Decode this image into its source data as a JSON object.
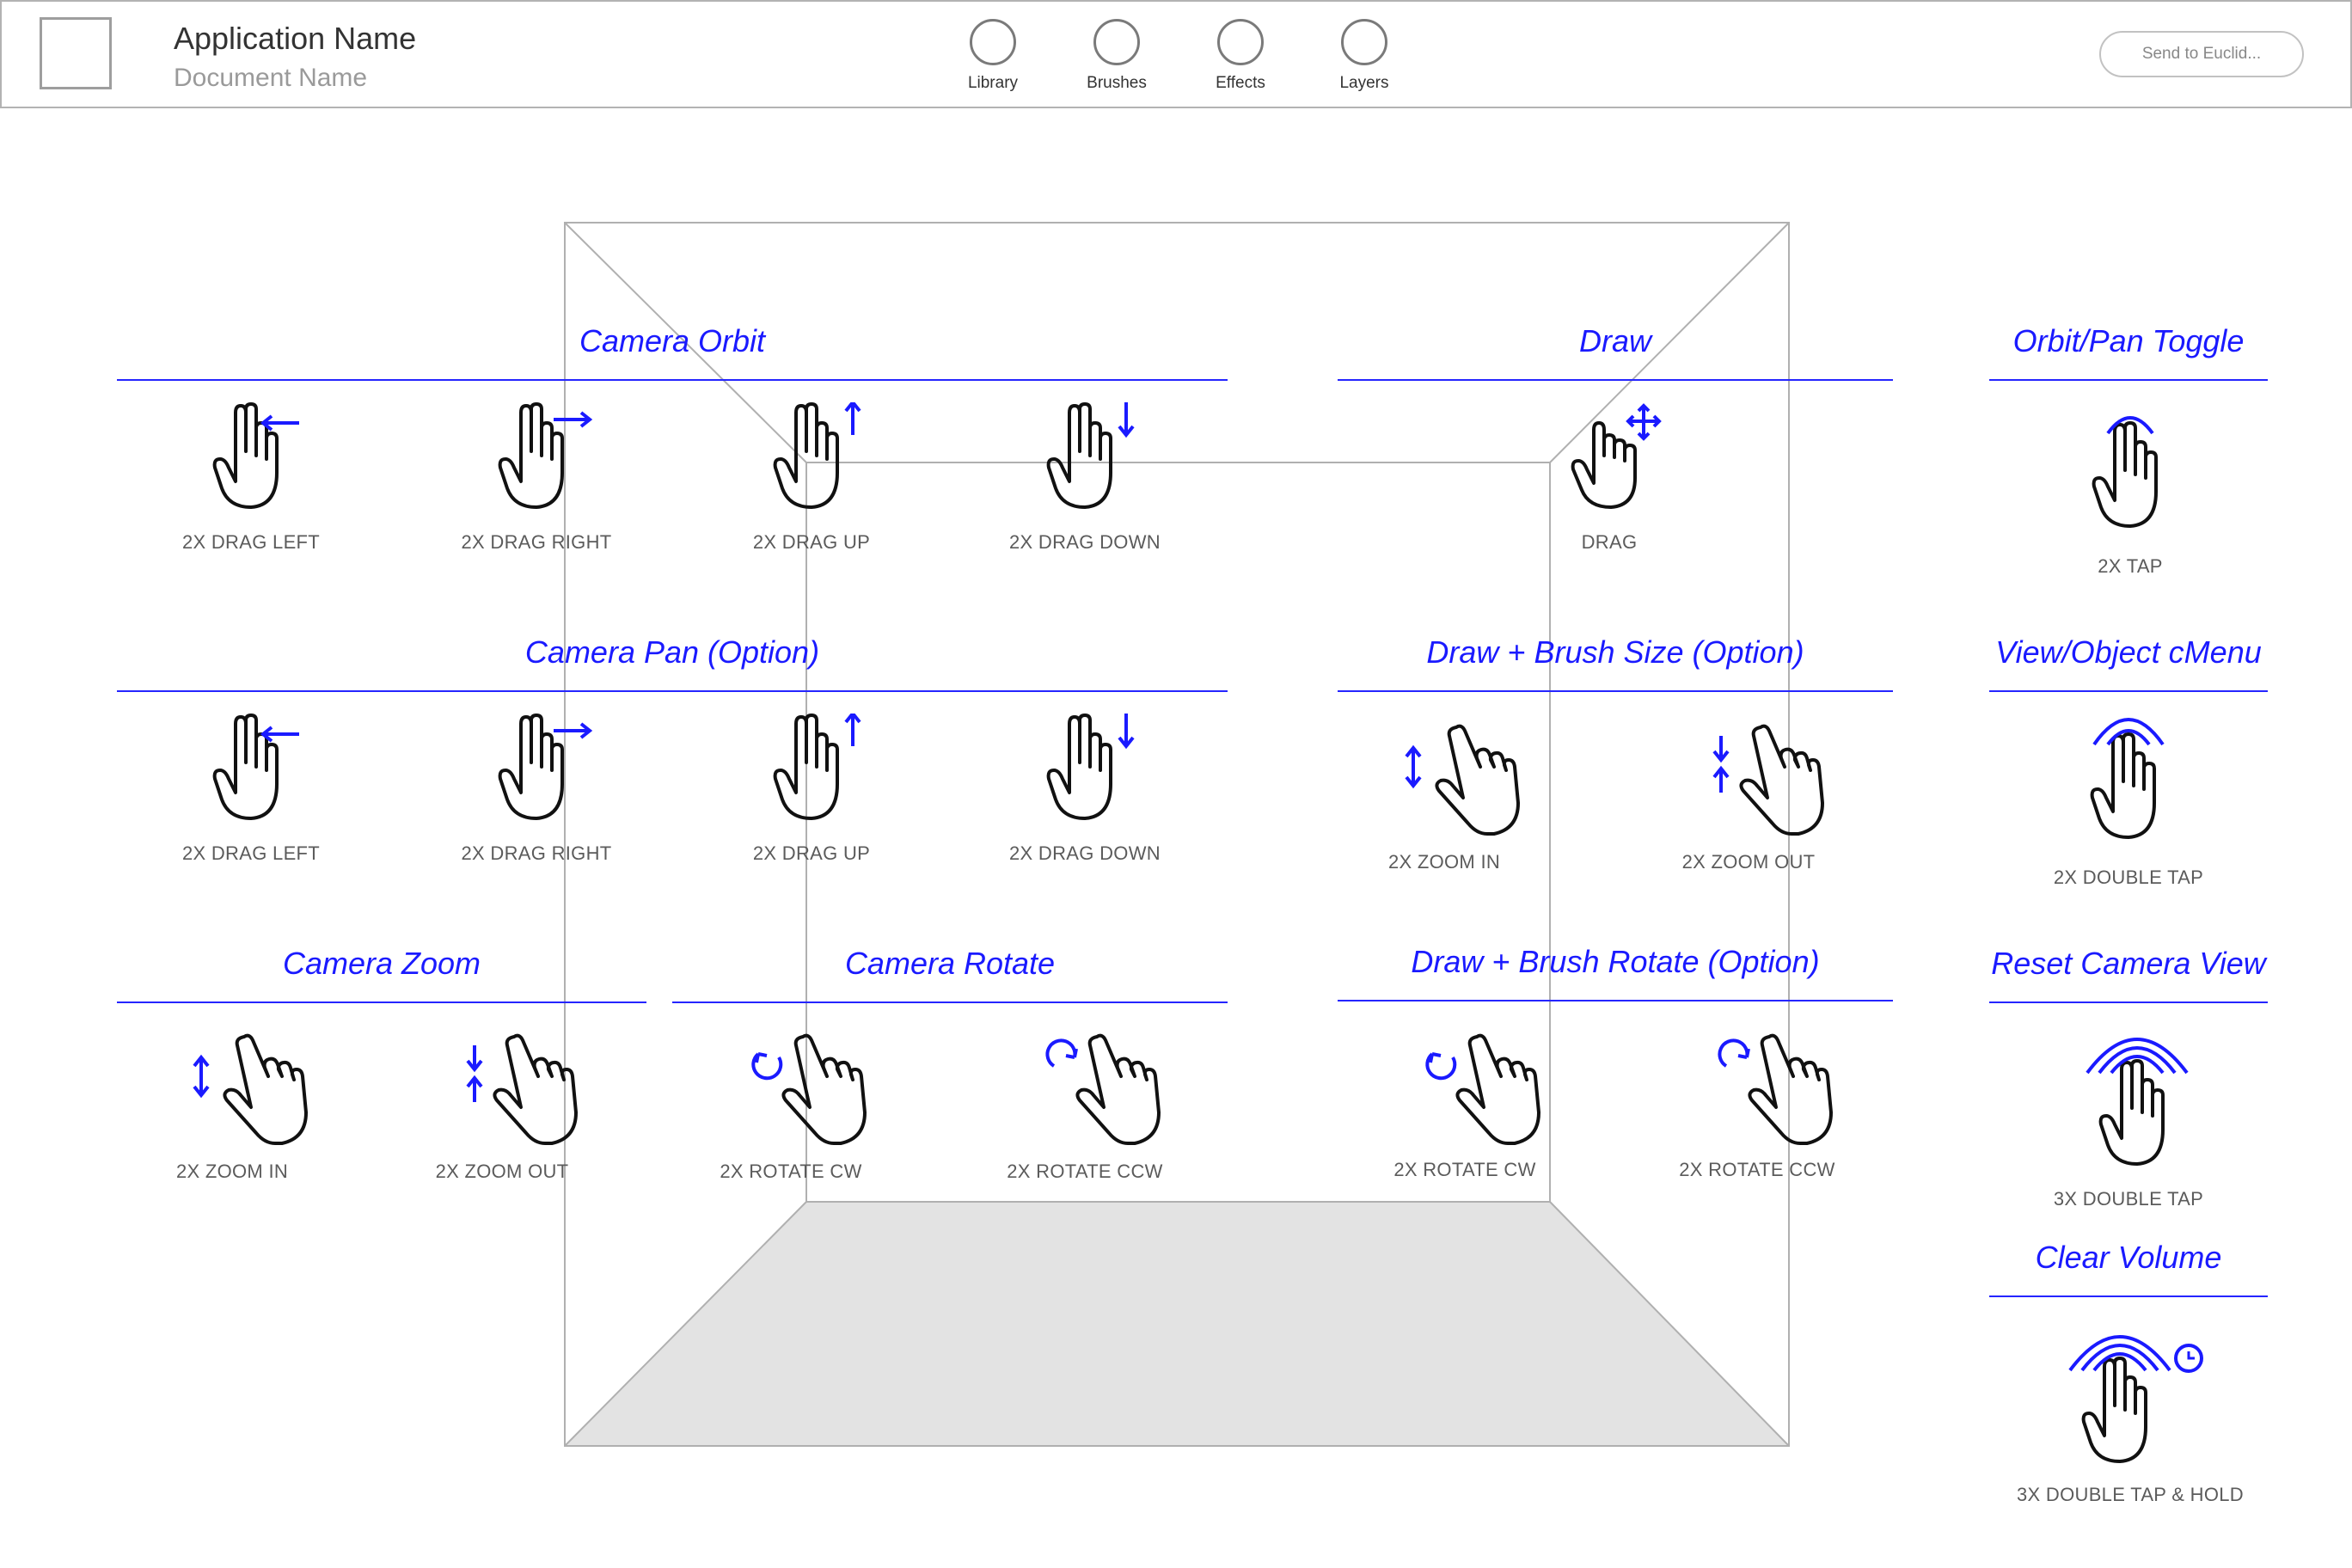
{
  "header": {
    "app_name": "Application Name",
    "document_name": "Document Name",
    "tools": [
      {
        "label": "Library"
      },
      {
        "label": "Brushes"
      },
      {
        "label": "Effects"
      },
      {
        "label": "Layers"
      }
    ],
    "send_button": "Send to Euclid..."
  },
  "colors": {
    "accent": "#1a1aff",
    "label": "#5b5b5b",
    "floor": "#e3e3e3"
  },
  "sections": {
    "camera_orbit": {
      "title": "Camera Orbit",
      "items": [
        "2X DRAG LEFT",
        "2X DRAG RIGHT",
        "2X DRAG UP",
        "2X DRAG DOWN"
      ]
    },
    "draw": {
      "title": "Draw",
      "items": [
        "DRAG"
      ]
    },
    "orbit_pan_toggle": {
      "title": "Orbit/Pan Toggle",
      "items": [
        "2X TAP"
      ]
    },
    "camera_pan": {
      "title": "Camera Pan (Option)",
      "items": [
        "2X DRAG LEFT",
        "2X DRAG RIGHT",
        "2X DRAG UP",
        "2X DRAG DOWN"
      ]
    },
    "draw_brush_size": {
      "title": "Draw + Brush Size (Option)",
      "items": [
        "2X ZOOM IN",
        "2X ZOOM OUT"
      ]
    },
    "view_object_cmenu": {
      "title": "View/Object cMenu",
      "items": [
        "2X DOUBLE TAP"
      ]
    },
    "camera_zoom": {
      "title": "Camera Zoom",
      "items": [
        "2X ZOOM IN",
        "2X ZOOM OUT"
      ]
    },
    "camera_rotate": {
      "title": "Camera Rotate",
      "items": [
        "2X ROTATE CW",
        "2X ROTATE CCW"
      ]
    },
    "draw_brush_rotate": {
      "title": "Draw + Brush Rotate (Option)",
      "items": [
        "2X ROTATE CW",
        "2X ROTATE CCW"
      ]
    },
    "reset_camera_view": {
      "title": "Reset Camera View",
      "items": [
        "3X DOUBLE TAP"
      ]
    },
    "clear_volume": {
      "title": "Clear Volume",
      "items": [
        "3X DOUBLE TAP & HOLD"
      ]
    }
  }
}
